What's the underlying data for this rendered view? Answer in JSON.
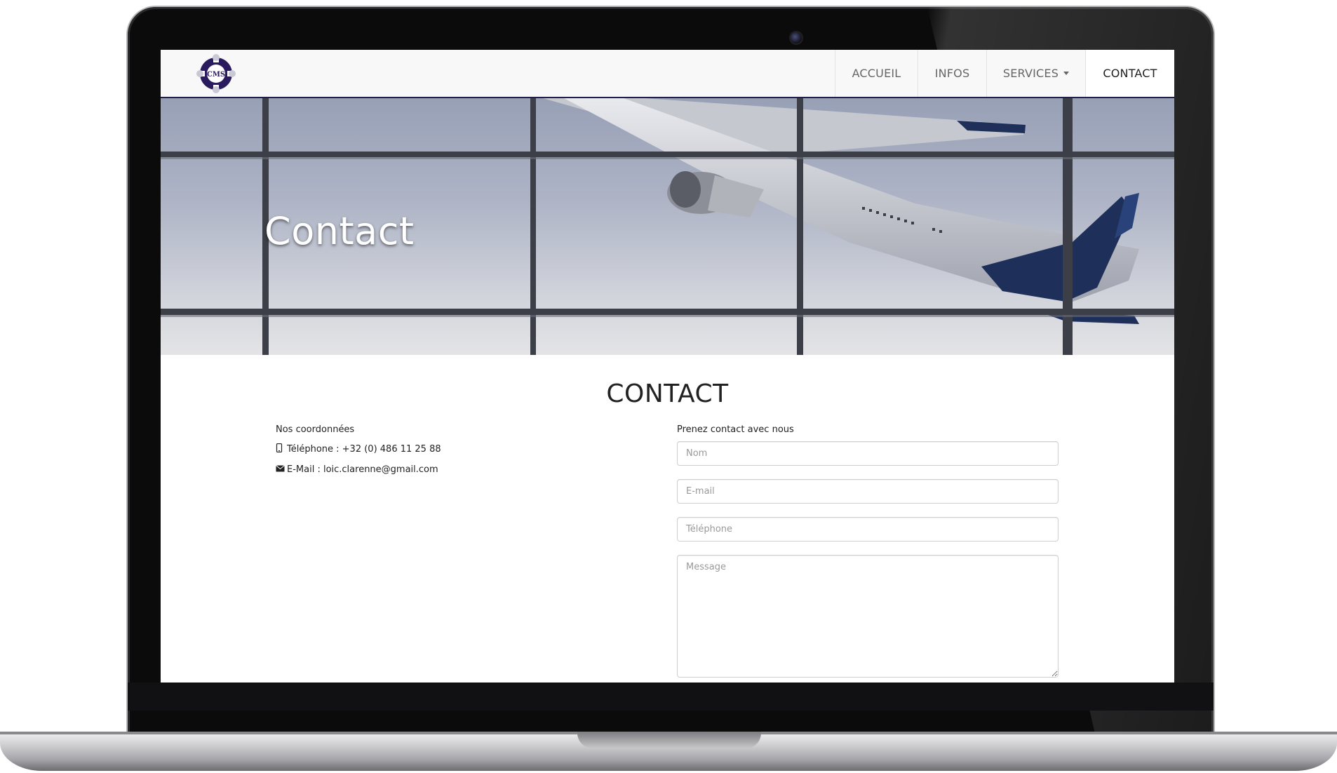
{
  "navbar": {
    "logo_text": "CMS",
    "items": [
      {
        "label": "ACCUEIL"
      },
      {
        "label": "INFOS"
      },
      {
        "label": "SERVICES"
      },
      {
        "label": "CONTACT"
      }
    ]
  },
  "hero": {
    "title": "Contact"
  },
  "main": {
    "section_title": "CONTACT",
    "coordinates": {
      "heading": "Nos coordonnées",
      "phone_icon": "mobile-phone-icon",
      "phone": "Téléphone : +32 (0) 486 11 25 88",
      "email_icon": "envelope-icon",
      "email": "E-Mail : loic.clarenne@gmail.com"
    },
    "form": {
      "heading": "Prenez contact avec nous",
      "name_placeholder": "Nom",
      "email_placeholder": "E-mail",
      "phone_placeholder": "Téléphone",
      "message_placeholder": "Message"
    }
  },
  "colors": {
    "nav_border": "#1f1f4a",
    "logo": "#2a1a5e"
  }
}
